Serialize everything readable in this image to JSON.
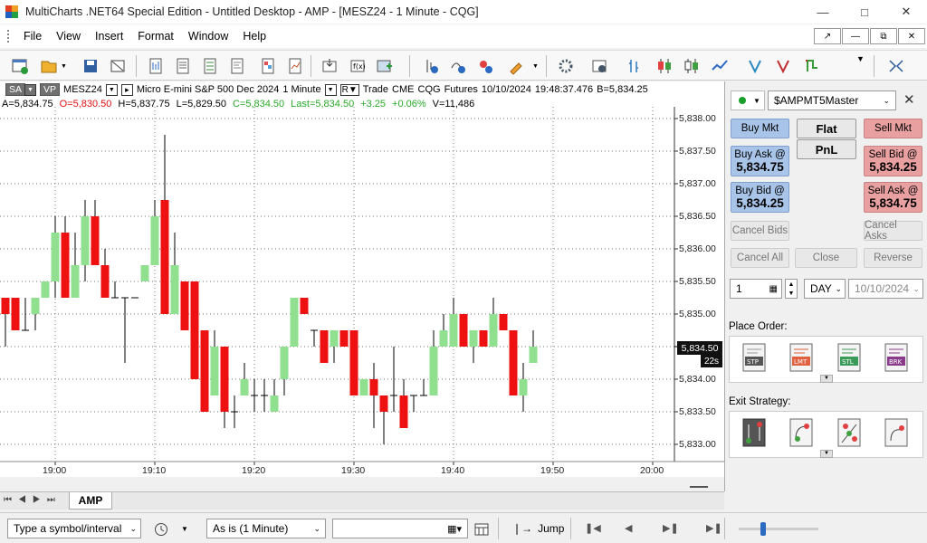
{
  "window": {
    "title": "MultiCharts .NET64 Special Edition - Untitled Desktop - AMP - [MESZ24 - 1 Minute - CQG]"
  },
  "menu": [
    "File",
    "View",
    "Insert",
    "Format",
    "Window",
    "Help"
  ],
  "chart_header": {
    "sa": "SA",
    "vp": "VP",
    "symbol": "MESZ24",
    "description": "Micro E-mini S&P 500 Dec 2024",
    "interval": "1 Minute",
    "r_label": "R",
    "source": "Trade",
    "exchange": "CME",
    "feed": "CQG",
    "category": "Futures",
    "date": "10/10/2024",
    "time": "19:48:37.476",
    "bid": "B=5,834.25"
  },
  "ohlc": {
    "ask": "A=5,834.75",
    "open": "O=5,830.50",
    "high": "H=5,837.75",
    "low": "L=5,829.50",
    "close": "C=5,834.50",
    "last": "Last=5,834.50",
    "change": "+3.25",
    "pct": "+0.06%",
    "volume": "V=11,486"
  },
  "chart_data": {
    "type": "candlestick",
    "ylim": [
      5832.75,
      5838.25
    ],
    "y_ticks": [
      "5,838.00",
      "5,837.50",
      "5,837.00",
      "5,836.50",
      "5,836.00",
      "5,835.50",
      "5,835.00",
      "5,834.50",
      "5,834.00",
      "5,833.50",
      "5,833.00"
    ],
    "x_ticks": [
      "19:00",
      "19:10",
      "19:20",
      "19:30",
      "19:40",
      "19:50",
      "20:00"
    ],
    "current_price": "5,834.50",
    "countdown": "22s",
    "candles": [
      {
        "t": "18:55",
        "o": 5835.25,
        "h": 5835.25,
        "l": 5834.5,
        "c": 5835.0
      },
      {
        "t": "18:56",
        "o": 5835.25,
        "h": 5835.25,
        "l": 5834.75,
        "c": 5834.75
      },
      {
        "t": "18:57",
        "o": 5834.75,
        "h": 5835.25,
        "l": 5834.75,
        "c": 5834.75
      },
      {
        "t": "18:58",
        "o": 5835.0,
        "h": 5835.25,
        "l": 5834.75,
        "c": 5835.25
      },
      {
        "t": "18:59",
        "o": 5835.25,
        "h": 5835.5,
        "l": 5835.25,
        "c": 5835.5
      },
      {
        "t": "19:00",
        "o": 5835.5,
        "h": 5836.5,
        "l": 5835.25,
        "c": 5836.25
      },
      {
        "t": "19:01",
        "o": 5836.25,
        "h": 5836.5,
        "l": 5835.25,
        "c": 5835.25
      },
      {
        "t": "19:02",
        "o": 5835.25,
        "h": 5836.25,
        "l": 5835.25,
        "c": 5835.75
      },
      {
        "t": "19:03",
        "o": 5835.75,
        "h": 5836.75,
        "l": 5835.5,
        "c": 5836.5
      },
      {
        "t": "19:04",
        "o": 5836.5,
        "h": 5836.75,
        "l": 5835.75,
        "c": 5835.75
      },
      {
        "t": "19:05",
        "o": 5835.75,
        "h": 5836.0,
        "l": 5835.25,
        "c": 5835.25
      },
      {
        "t": "19:06",
        "o": 5835.25,
        "h": 5835.5,
        "l": 5835.25,
        "c": 5835.25
      },
      {
        "t": "19:07",
        "o": 5835.25,
        "h": 5835.25,
        "l": 5834.25,
        "c": 5835.25
      },
      {
        "t": "19:08",
        "o": 5835.25,
        "h": 5835.25,
        "l": 5835.25,
        "c": 5835.25
      },
      {
        "t": "19:09",
        "o": 5835.5,
        "h": 5835.75,
        "l": 5835.5,
        "c": 5835.75
      },
      {
        "t": "19:10",
        "o": 5835.75,
        "h": 5836.75,
        "l": 5835.75,
        "c": 5836.5
      },
      {
        "t": "19:11",
        "o": 5836.75,
        "h": 5837.75,
        "l": 5835.0,
        "c": 5835.0
      },
      {
        "t": "19:12",
        "o": 5835.0,
        "h": 5836.25,
        "l": 5835.0,
        "c": 5835.75
      },
      {
        "t": "19:13",
        "o": 5835.5,
        "h": 5835.5,
        "l": 5834.75,
        "c": 5834.75
      },
      {
        "t": "19:14",
        "o": 5835.5,
        "h": 5835.5,
        "l": 5834.0,
        "c": 5834.0
      },
      {
        "t": "19:15",
        "o": 5834.75,
        "h": 5834.75,
        "l": 5833.5,
        "c": 5833.5
      },
      {
        "t": "19:16",
        "o": 5833.75,
        "h": 5834.75,
        "l": 5833.75,
        "c": 5834.5
      },
      {
        "t": "19:17",
        "o": 5834.5,
        "h": 5834.5,
        "l": 5833.25,
        "c": 5833.5
      },
      {
        "t": "19:18",
        "o": 5833.5,
        "h": 5833.75,
        "l": 5833.25,
        "c": 5833.5
      },
      {
        "t": "19:19",
        "o": 5833.75,
        "h": 5834.25,
        "l": 5833.75,
        "c": 5834.0
      },
      {
        "t": "19:20",
        "o": 5833.75,
        "h": 5834.0,
        "l": 5833.5,
        "c": 5833.75
      },
      {
        "t": "19:21",
        "o": 5833.75,
        "h": 5834.0,
        "l": 5833.5,
        "c": 5833.75
      },
      {
        "t": "19:22",
        "o": 5833.5,
        "h": 5834.0,
        "l": 5833.5,
        "c": 5833.75
      },
      {
        "t": "19:23",
        "o": 5834.0,
        "h": 5834.5,
        "l": 5833.75,
        "c": 5834.5
      },
      {
        "t": "19:24",
        "o": 5834.5,
        "h": 5835.25,
        "l": 5834.5,
        "c": 5835.25
      },
      {
        "t": "19:25",
        "o": 5835.25,
        "h": 5835.25,
        "l": 5835.0,
        "c": 5835.0
      },
      {
        "t": "19:26",
        "o": 5834.75,
        "h": 5834.75,
        "l": 5834.5,
        "c": 5834.75
      },
      {
        "t": "19:27",
        "o": 5834.75,
        "h": 5834.75,
        "l": 5834.25,
        "c": 5834.25
      },
      {
        "t": "19:28",
        "o": 5834.5,
        "h": 5834.75,
        "l": 5834.25,
        "c": 5834.75
      },
      {
        "t": "19:29",
        "o": 5834.75,
        "h": 5834.75,
        "l": 5834.5,
        "c": 5834.5
      },
      {
        "t": "19:30",
        "o": 5834.75,
        "h": 5834.75,
        "l": 5833.75,
        "c": 5833.75
      },
      {
        "t": "19:31",
        "o": 5833.75,
        "h": 5834.0,
        "l": 5833.75,
        "c": 5834.0
      },
      {
        "t": "19:32",
        "o": 5834.0,
        "h": 5834.25,
        "l": 5833.25,
        "c": 5833.75
      },
      {
        "t": "19:33",
        "o": 5833.75,
        "h": 5833.75,
        "l": 5833.0,
        "c": 5833.5
      },
      {
        "t": "19:34",
        "o": 5833.75,
        "h": 5834.5,
        "l": 5833.5,
        "c": 5833.75
      },
      {
        "t": "19:35",
        "o": 5833.75,
        "h": 5834.0,
        "l": 5833.25,
        "c": 5833.25
      },
      {
        "t": "19:36",
        "o": 5833.75,
        "h": 5833.75,
        "l": 5833.5,
        "c": 5833.75
      },
      {
        "t": "19:37",
        "o": 5833.75,
        "h": 5834.0,
        "l": 5833.75,
        "c": 5833.75
      },
      {
        "t": "19:38",
        "o": 5833.75,
        "h": 5834.75,
        "l": 5833.75,
        "c": 5834.5
      },
      {
        "t": "19:39",
        "o": 5834.5,
        "h": 5835.0,
        "l": 5834.5,
        "c": 5834.75
      },
      {
        "t": "19:40",
        "o": 5834.5,
        "h": 5835.25,
        "l": 5834.5,
        "c": 5835.0
      },
      {
        "t": "19:41",
        "o": 5835.0,
        "h": 5835.0,
        "l": 5834.5,
        "c": 5834.5
      },
      {
        "t": "19:42",
        "o": 5834.5,
        "h": 5834.75,
        "l": 5834.25,
        "c": 5834.75
      },
      {
        "t": "19:43",
        "o": 5834.75,
        "h": 5834.75,
        "l": 5834.5,
        "c": 5834.5
      },
      {
        "t": "19:44",
        "o": 5834.5,
        "h": 5835.25,
        "l": 5834.5,
        "c": 5835.0
      },
      {
        "t": "19:45",
        "o": 5835.0,
        "h": 5835.0,
        "l": 5834.75,
        "c": 5834.75
      },
      {
        "t": "19:46",
        "o": 5834.75,
        "h": 5834.75,
        "l": 5833.75,
        "c": 5833.75
      },
      {
        "t": "19:47",
        "o": 5833.75,
        "h": 5834.25,
        "l": 5833.5,
        "c": 5834.0
      },
      {
        "t": "19:48",
        "o": 5834.25,
        "h": 5834.75,
        "l": 5834.25,
        "c": 5834.5
      }
    ]
  },
  "tabs": {
    "active": "AMP"
  },
  "bottom": {
    "symbol_placeholder": "Type a symbol/interval",
    "resolution": "As is (1 Minute)",
    "date_value": "",
    "jump": "Jump"
  },
  "trading": {
    "account": "$AMPMT5Master",
    "buy_mkt": "Buy Mkt",
    "sell_mkt": "Sell Mkt",
    "position": "Flat",
    "pnl": "PnL",
    "buy_ask_label": "Buy Ask @",
    "buy_ask_price": "5,834.75",
    "sell_bid_label": "Sell Bid @",
    "sell_bid_price": "5,834.25",
    "buy_bid_label": "Buy Bid @",
    "buy_bid_price": "5,834.25",
    "sell_ask_label": "Sell Ask @",
    "sell_ask_price": "5,834.75",
    "cancel_bids": "Cancel Bids",
    "cancel_asks": "Cancel Asks",
    "cancel_all": "Cancel All",
    "close": "Close",
    "reverse": "Reverse",
    "quantity": "1",
    "tif": "DAY",
    "tif_date": "10/10/2024",
    "place_order": "Place Order:",
    "exit_strategy": "Exit Strategy:",
    "order_types": [
      "STP",
      "LMT",
      "STL",
      "BRK"
    ]
  },
  "colors": {
    "up": "#90e090",
    "down": "#ee1111",
    "buy": "#a8c4e8",
    "sell": "#e8a0a0"
  }
}
